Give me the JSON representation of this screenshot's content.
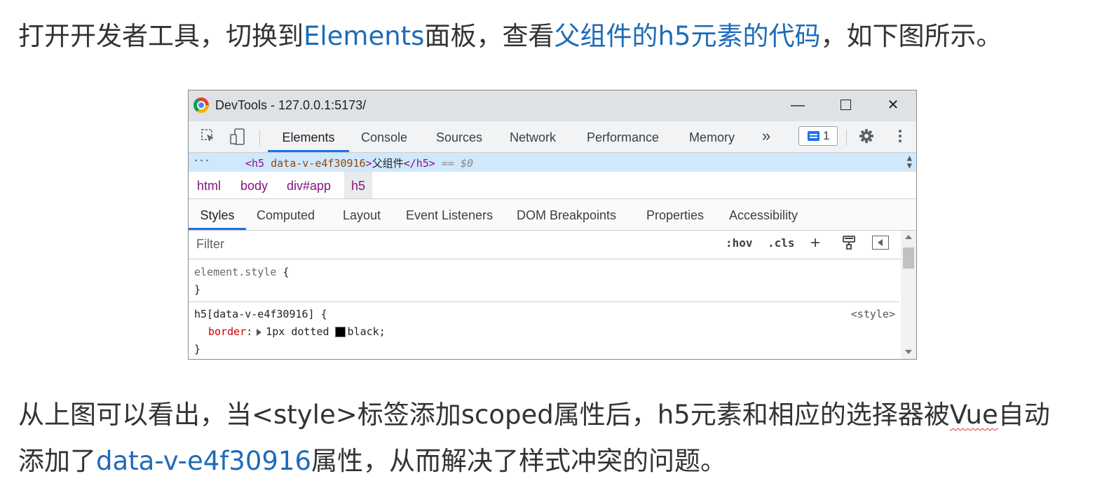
{
  "paragraph1": {
    "prefix": "打开开发者工具，切换到",
    "highlight1": "Elements",
    "middle": "面板，查看",
    "highlight2": "父组件的h5元素的代码",
    "suffix": "，如下图所示。"
  },
  "paragraph2": {
    "line1_before": "从上图可以看出，当<style>标签添加scoped属性后，h5元素和相应的选择器被",
    "line1_underlined": "Vue",
    "line1_after": "自动",
    "line2_prefix": "添加了",
    "line2_highlight": "data-v-e4f30916",
    "line2_suffix": "属性，从而解决了样式冲突的问题。"
  },
  "colors": {
    "highlight": "#1e6bb8",
    "tab_accent": "#1a73e8",
    "selected_node_bg": "#cfe8fc"
  },
  "devtools": {
    "window_title": "DevTools - 127.0.0.1:5173/",
    "window_controls": {
      "minimize": "—",
      "maximize": "□",
      "close": "✕"
    },
    "toolbar": {
      "inspect_icon": "select-element-icon",
      "device_icon": "device-toolbar-icon",
      "tabs": [
        "Elements",
        "Console",
        "Sources",
        "Network",
        "Performance",
        "Memory"
      ],
      "active_tab": "Elements",
      "more_tabs": "»",
      "issues_count": "1",
      "settings_icon": "gear-icon",
      "menu_icon": "kebab-icon"
    },
    "selected_node": {
      "ellipsis": "···",
      "open_tag_start": "<h5 ",
      "attr_name": "data-v-e4f30916",
      "open_tag_end": ">",
      "text": "父组件",
      "close_tag": "</h5>",
      "equals": " == ",
      "console_ref": "$0"
    },
    "breadcrumb": [
      "html",
      "body",
      "div#app",
      "h5"
    ],
    "subtabs": [
      "Styles",
      "Computed",
      "Layout",
      "Event Listeners",
      "DOM Breakpoints",
      "Properties",
      "Accessibility"
    ],
    "active_subtab": "Styles",
    "filter": {
      "placeholder": "Filter",
      "value": ""
    },
    "filter_buttons": {
      "hov": ":hov",
      "cls": ".cls",
      "new_rule": "+"
    },
    "rules": [
      {
        "selector": "element.style",
        "open": " {",
        "close": "}",
        "origin": "",
        "declarations": []
      },
      {
        "selector": "h5[data-v-e4f30916]",
        "open": " {",
        "close": "}",
        "origin": "<style>",
        "declarations": [
          {
            "name": "border",
            "colon": ":",
            "value_before": "1px dotted",
            "swatch_color": "#000000",
            "value_after": "black;"
          }
        ]
      }
    ]
  }
}
